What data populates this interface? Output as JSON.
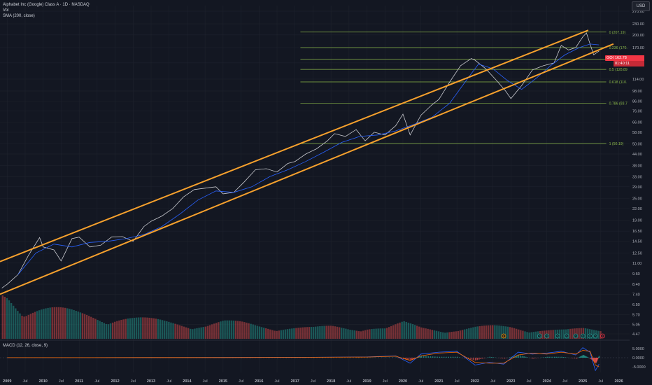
{
  "header": {
    "title": "Alphabet Inc (Google) Class A · 1D · NASDAQ",
    "vol_label": "Vol",
    "sma_label": "SMA (200, close)",
    "currency": "USD"
  },
  "price_tag": {
    "ticker": "GOOGL",
    "price": "162.78",
    "countdown": "01:40:11",
    "color": "#f23645"
  },
  "macd_label": "MACD (12, 26, close, 9)",
  "colors": {
    "background": "#131722",
    "channel": "#f7a12d",
    "sma": "#2962ff",
    "fib": "#8bb84a",
    "candle_up": "#26a69a",
    "candle_down": "#ef5350",
    "macd_line": "#2962ff",
    "signal_line": "#ff6d00"
  },
  "chart_data": {
    "type": "line",
    "title": "Alphabet Inc (Google) Class A · 1D · NASDAQ",
    "y_scale": "log",
    "ylim": [
      4.2,
      290
    ],
    "y_ticks": [
      "270.00",
      "230.00",
      "200.00",
      "170.00",
      "140.00",
      "114.00",
      "98.00",
      "86.00",
      "76.00",
      "66.00",
      "58.00",
      "50.00",
      "44.00",
      "38.00",
      "33.00",
      "29.00",
      "25.00",
      "22.00",
      "19.00",
      "16.50",
      "14.50",
      "12.50",
      "11.00",
      "9.60",
      "8.40",
      "7.40",
      "6.50",
      "5.70",
      "5.05",
      "4.47"
    ],
    "x_ticks": [
      "2009",
      "Jul",
      "2010",
      "Jul",
      "2011",
      "Jul",
      "2012",
      "Jul",
      "2013",
      "Jul",
      "2014",
      "Jul",
      "2015",
      "Jul",
      "2016",
      "Jul",
      "2017",
      "Jul",
      "2018",
      "Jul",
      "2019",
      "Jul",
      "2020",
      "Jul",
      "2021",
      "Jul",
      "2022",
      "Jul",
      "2023",
      "Jul",
      "2024",
      "Jul",
      "2025",
      "Jul",
      "2026"
    ],
    "xlim": [
      2008.8,
      2026.3
    ],
    "price_series": {
      "x": [
        2008.85,
        2009.0,
        2009.3,
        2009.6,
        2009.9,
        2010.0,
        2010.3,
        2010.5,
        2010.8,
        2011.0,
        2011.3,
        2011.6,
        2011.9,
        2012.2,
        2012.5,
        2012.8,
        2013.0,
        2013.3,
        2013.6,
        2013.9,
        2014.2,
        2014.5,
        2014.8,
        2015.0,
        2015.3,
        2015.6,
        2015.9,
        2016.2,
        2016.5,
        2016.8,
        2017.0,
        2017.3,
        2017.6,
        2017.9,
        2018.1,
        2018.4,
        2018.7,
        2018.95,
        2019.2,
        2019.5,
        2019.8,
        2020.0,
        2020.2,
        2020.5,
        2020.8,
        2021.0,
        2021.3,
        2021.6,
        2021.9,
        2022.0,
        2022.3,
        2022.6,
        2022.85,
        2023.0,
        2023.3,
        2023.6,
        2023.9,
        2024.2,
        2024.4,
        2024.6,
        2024.8,
        2025.0,
        2025.1,
        2025.3,
        2025.45
      ],
      "y": [
        8.0,
        8.4,
        9.5,
        12.2,
        15.2,
        13.5,
        13.0,
        11.3,
        15.0,
        15.3,
        13.5,
        13.8,
        15.3,
        15.4,
        14.5,
        17.5,
        18.7,
        20.0,
        22.0,
        25.5,
        28.0,
        28.5,
        29.0,
        26.5,
        27.0,
        31.0,
        36.0,
        36.5,
        35.0,
        39.0,
        40.0,
        44.0,
        47.0,
        52.0,
        57.0,
        55.0,
        60.0,
        52.0,
        58.0,
        56.0,
        63.0,
        73.0,
        56.0,
        72.0,
        82.0,
        88.0,
        110.0,
        135.0,
        148.0,
        145.0,
        130.0,
        112.0,
        98.0,
        89.0,
        105.0,
        128.0,
        135.0,
        140.0,
        175.0,
        165.0,
        170.0,
        195.0,
        205.0,
        155.0,
        162.78
      ]
    },
    "sma_series": {
      "name": "SMA (200, close)",
      "x": [
        2009.3,
        2009.8,
        2010.3,
        2010.8,
        2011.3,
        2011.8,
        2012.3,
        2012.8,
        2013.3,
        2013.8,
        2014.3,
        2014.8,
        2015.3,
        2015.8,
        2016.3,
        2016.8,
        2017.3,
        2017.8,
        2018.3,
        2018.8,
        2019.3,
        2019.8,
        2020.3,
        2020.8,
        2021.3,
        2021.8,
        2022.1,
        2022.5,
        2022.9,
        2023.3,
        2023.7,
        2024.1,
        2024.5,
        2024.9,
        2025.2,
        2025.45
      ],
      "y": [
        9.5,
        12.5,
        14.0,
        13.5,
        14.3,
        14.5,
        15.0,
        15.8,
        17.5,
        20.5,
        24.5,
        27.5,
        27.0,
        29.0,
        33.0,
        36.0,
        40.0,
        45.0,
        51.0,
        55.0,
        56.0,
        59.0,
        64.0,
        70.0,
        84.0,
        115.0,
        138.0,
        130.0,
        112.0,
        100.0,
        115.0,
        135.0,
        155.0,
        170.0,
        178.0,
        176.0
      ]
    },
    "channel": {
      "upper": {
        "x": [
          2008.8,
          2025.15
        ],
        "y": [
          11.2,
          212.0
        ]
      },
      "lower": {
        "x": [
          2008.8,
          2025.85
        ],
        "y": [
          7.4,
          178.0
        ]
      }
    },
    "fib_levels": [
      {
        "ratio": "0",
        "value": 207.19,
        "label": "0 (207.19)"
      },
      {
        "ratio": "0.236",
        "value": 170.0,
        "label": "0.236 (170."
      },
      {
        "ratio": "0.382",
        "value": 147.0,
        "label": "0.382"
      },
      {
        "ratio": "0.5",
        "value": 128.89,
        "label": "0.5 (128.89"
      },
      {
        "ratio": "0.618",
        "value": 110.0,
        "label": "0.618 (110."
      },
      {
        "ratio": "0.786",
        "value": 83.7,
        "label": "0.786 (83.7"
      },
      {
        "ratio": "1",
        "value": 50.19,
        "label": "1 (50.19)"
      }
    ],
    "fib_x_range": [
      2017.15,
      2025.65
    ],
    "volume": {
      "x": [
        2009.0,
        2009.5,
        2010.0,
        2010.5,
        2011.0,
        2011.5,
        2012.0,
        2012.5,
        2013.0,
        2013.5,
        2014.0,
        2014.5,
        2015.0,
        2015.5,
        2016.0,
        2016.5,
        2017.0,
        2017.5,
        2018.0,
        2018.5,
        2019.0,
        2019.5,
        2020.0,
        2020.5,
        2021.0,
        2021.5,
        2022.0,
        2022.5,
        2023.0,
        2023.5,
        2024.0,
        2024.5,
        2025.0,
        2025.4
      ],
      "values": [
        0.8,
        0.6,
        0.55,
        0.5,
        0.45,
        0.42,
        0.4,
        0.36,
        0.33,
        0.3,
        0.28,
        0.25,
        0.3,
        0.28,
        0.24,
        0.22,
        0.2,
        0.19,
        0.22,
        0.2,
        0.22,
        0.18,
        0.28,
        0.2,
        0.18,
        0.16,
        0.2,
        0.22,
        0.22,
        0.18,
        0.16,
        0.15,
        0.18,
        0.16
      ]
    },
    "macd_ticks": [
      "5.0000",
      "0.0000",
      "-5.0000"
    ],
    "macd": {
      "x": [
        2009.0,
        2011.0,
        2013.0,
        2015.0,
        2017.0,
        2019.0,
        2019.8,
        2020.2,
        2020.5,
        2021.0,
        2021.5,
        2022.0,
        2022.4,
        2022.8,
        2023.2,
        2023.6,
        2024.0,
        2024.4,
        2024.8,
        2025.0,
        2025.2,
        2025.35,
        2025.45
      ],
      "macd": [
        0.05,
        0.05,
        0.08,
        0.1,
        0.2,
        0.4,
        1.0,
        -3.0,
        2.0,
        3.0,
        3.5,
        -4.0,
        -2.5,
        -3.5,
        3.0,
        2.0,
        2.5,
        3.5,
        1.5,
        5.5,
        3.0,
        -7.0,
        -3.5
      ],
      "signal": [
        0.04,
        0.04,
        0.07,
        0.09,
        0.18,
        0.35,
        0.8,
        -1.5,
        1.0,
        2.5,
        3.0,
        -2.5,
        -3.0,
        -3.0,
        1.5,
        2.5,
        2.0,
        3.0,
        2.0,
        4.0,
        3.5,
        -4.0,
        -5.0
      ],
      "ylim": [
        -8,
        8
      ]
    }
  },
  "markers": {
    "earnings_label": "E",
    "dividend_label": "D",
    "split_label": "S"
  }
}
